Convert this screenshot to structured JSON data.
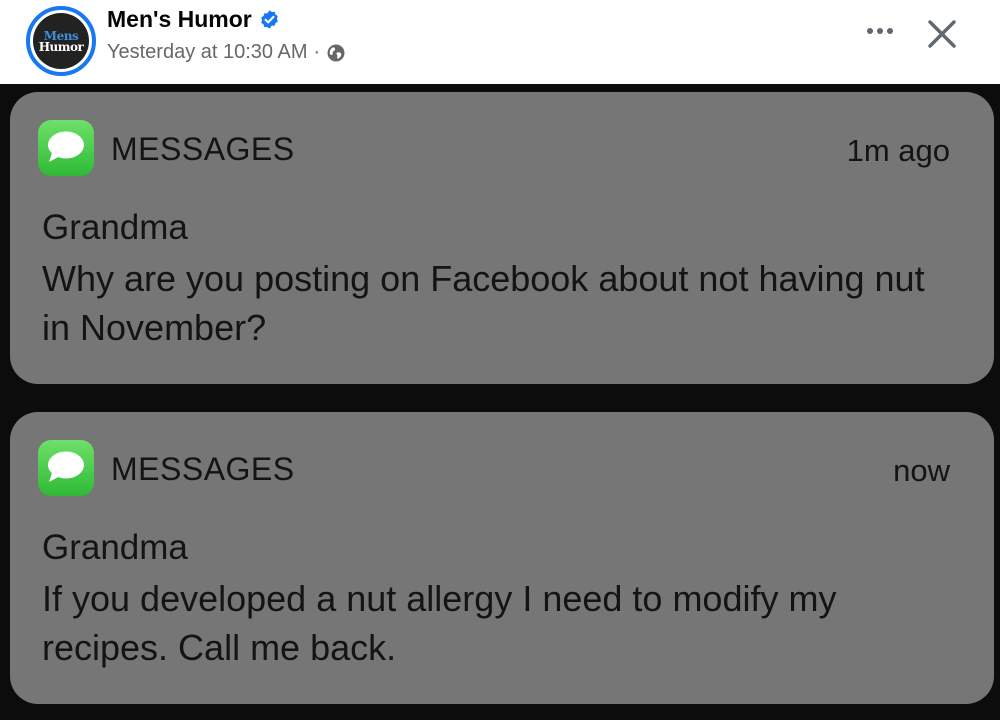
{
  "post": {
    "author": "Men's Humor",
    "avatar_text": [
      "Mens",
      "Humor"
    ],
    "timestamp": "Yesterday at 10:30 AM",
    "separator": "·",
    "audience_icon": "globe-icon",
    "verified_icon": "verified-badge-icon",
    "more_icon": "more-options-icon",
    "close_icon": "close-icon"
  },
  "notifications": [
    {
      "app": "MESSAGES",
      "time": "1m ago",
      "sender": "Grandma",
      "message": "Why are you posting on Facebook about not having nut in November?"
    },
    {
      "app": "MESSAGES",
      "time": "now",
      "sender": "Grandma",
      "message": "If you developed a nut allergy I need to modify my recipes. Call me back."
    }
  ],
  "colors": {
    "verified": "#1877f2",
    "notification_bg": "#767676",
    "app_icon": "#3ec443",
    "photo_bg": "#0c0c0c"
  }
}
